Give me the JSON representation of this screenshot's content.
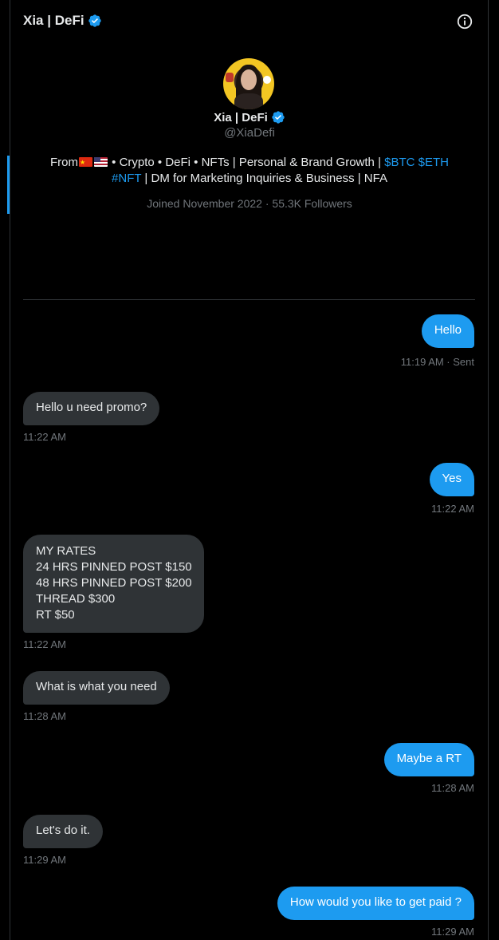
{
  "header": {
    "title": "Xia | DeFi",
    "info_icon": "info-icon",
    "verified_icon": "verified-badge-icon"
  },
  "profile": {
    "name": "Xia | DeFi",
    "handle": "@XiaDefi",
    "bio": {
      "part1": "From",
      "part2": " • Crypto • DeFi • NFTs | Personal & Brand Growth | ",
      "link1": "$BTC",
      "sep": " ",
      "link2": "$ETH",
      "link3": "#NFT",
      "part3": " | DM for Marketing Inquiries & Business | NFA"
    },
    "joined": "Joined November 2022",
    "dot": " · ",
    "followers": "55.3K Followers"
  },
  "messages": [
    {
      "text": "Hello",
      "time": "11:19 AM · Sent",
      "direction": "out"
    },
    {
      "text": "Hello u need promo?",
      "time": "11:22 AM",
      "direction": "in"
    },
    {
      "text": "Yes",
      "time": "11:22 AM",
      "direction": "out"
    },
    {
      "lines": [
        "MY RATES",
        "24 HRS PINNED POST $150",
        "48 HRS PINNED POST $200",
        "THREAD $300",
        "RT $50"
      ],
      "time": "11:22 AM",
      "direction": "in"
    },
    {
      "text": "What is what you need",
      "time": "11:28 AM",
      "direction": "in"
    },
    {
      "text": "Maybe a RT",
      "time": "11:28 AM",
      "direction": "out"
    },
    {
      "text": "Let's do it.",
      "time": "11:29 AM",
      "direction": "in"
    },
    {
      "text": "How would you like to get paid ?",
      "time": "11:29 AM",
      "direction": "out"
    }
  ],
  "colors": {
    "background": "#000000",
    "accent": "#1d9bf0",
    "incoming_bubble": "#2f3336",
    "muted_text": "#71767b"
  }
}
